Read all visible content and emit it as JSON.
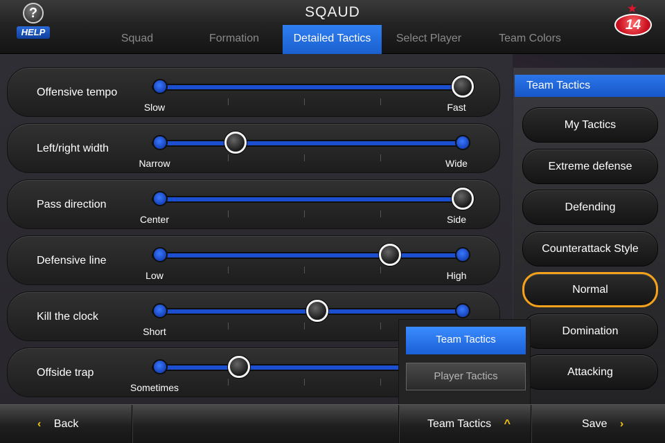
{
  "header": {
    "title": "SQAUD",
    "help_label": "HELP",
    "help_glyph": "?",
    "logo_text": "14"
  },
  "tabs": [
    {
      "label": "Squad",
      "active": false
    },
    {
      "label": "Formation",
      "active": false
    },
    {
      "label": "Detailed Tactics",
      "active": true
    },
    {
      "label": "Select Player",
      "active": false
    },
    {
      "label": "Team Colors",
      "active": false
    }
  ],
  "sliders": [
    {
      "label": "Offensive tempo",
      "min_label": "Slow",
      "max_label": "Fast",
      "value": 1.0
    },
    {
      "label": "Left/right width",
      "min_label": "Narrow",
      "max_label": "Wide",
      "value": 0.25
    },
    {
      "label": "Pass direction",
      "min_label": "Center",
      "max_label": "Side",
      "value": 1.0
    },
    {
      "label": "Defensive line",
      "min_label": "Low",
      "max_label": "High",
      "value": 0.76
    },
    {
      "label": "Kill the clock",
      "min_label": "Short",
      "max_label": "",
      "value": 0.52
    },
    {
      "label": "Offside trap",
      "min_label": "Sometimes",
      "max_label": "",
      "value": 0.26
    }
  ],
  "team_tactics": {
    "title": "Team Tactics",
    "options": [
      {
        "label": "My Tactics",
        "selected": false
      },
      {
        "label": "Extreme defense",
        "selected": false
      },
      {
        "label": "Defending",
        "selected": false
      },
      {
        "label": "Counterattack Style",
        "selected": false
      },
      {
        "label": "Normal",
        "selected": true
      },
      {
        "label": "Domination",
        "selected": false
      },
      {
        "label": "Attacking",
        "selected": false
      }
    ]
  },
  "popup": {
    "items": [
      {
        "label": "Team Tactics",
        "active": true
      },
      {
        "label": "Player Tactics",
        "active": false
      }
    ]
  },
  "bottom_bar": {
    "back_label": "Back",
    "menu_label": "Team Tactics",
    "save_label": "Save"
  },
  "colors": {
    "accent_blue": "#2b76ea",
    "selected_outline": "#f4a21c",
    "chevron": "#f5c60f",
    "logo_red": "#c80f1f"
  }
}
